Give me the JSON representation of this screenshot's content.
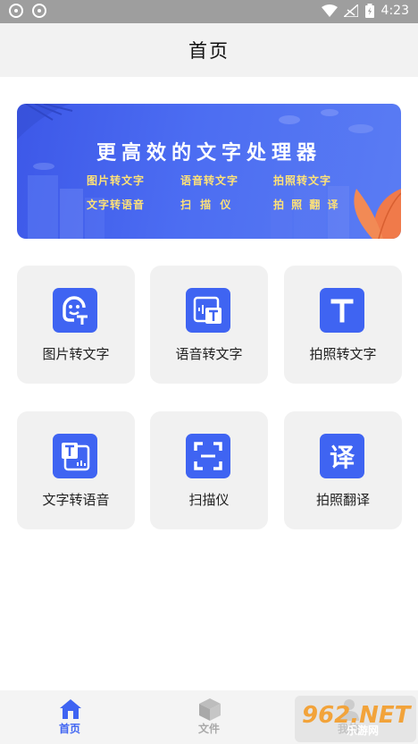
{
  "status_bar": {
    "time": "4:23",
    "left_icons": [
      "sync-icon",
      "sync-icon"
    ],
    "right_icons": [
      "wifi-icon",
      "signal-icon",
      "battery-icon"
    ]
  },
  "header": {
    "title": "首页"
  },
  "banner": {
    "headline": "更高效的文字处理器",
    "features": [
      "图片转文字",
      "语音转文字",
      "拍照转文字",
      "文字转语音",
      "扫 描 仪",
      "拍 照 翻 译"
    ],
    "feature_color": "#ffe277",
    "background": "#4a66f0"
  },
  "tools": [
    {
      "label": "图片转文字",
      "icon": "image-to-text-icon"
    },
    {
      "label": "语音转文字",
      "icon": "voice-to-text-icon"
    },
    {
      "label": "拍照转文字",
      "icon": "text-t-icon"
    },
    {
      "label": "文字转语音",
      "icon": "text-to-voice-icon"
    },
    {
      "label": "扫描仪",
      "icon": "scanner-icon"
    },
    {
      "label": "拍照翻译",
      "icon": "translate-icon"
    }
  ],
  "bottom_nav": {
    "items": [
      {
        "label": "首页",
        "icon": "home-icon",
        "active": true
      },
      {
        "label": "文件",
        "icon": "box-icon",
        "active": false
      },
      {
        "label": "我的",
        "icon": "person-icon",
        "active": false
      }
    ]
  },
  "watermark": {
    "text": "962.NET",
    "subtext": "乐游网"
  },
  "colors": {
    "accent": "#3f64f2",
    "tile_bg": "#f1f1f1",
    "header_bg": "#f2f2f2"
  }
}
